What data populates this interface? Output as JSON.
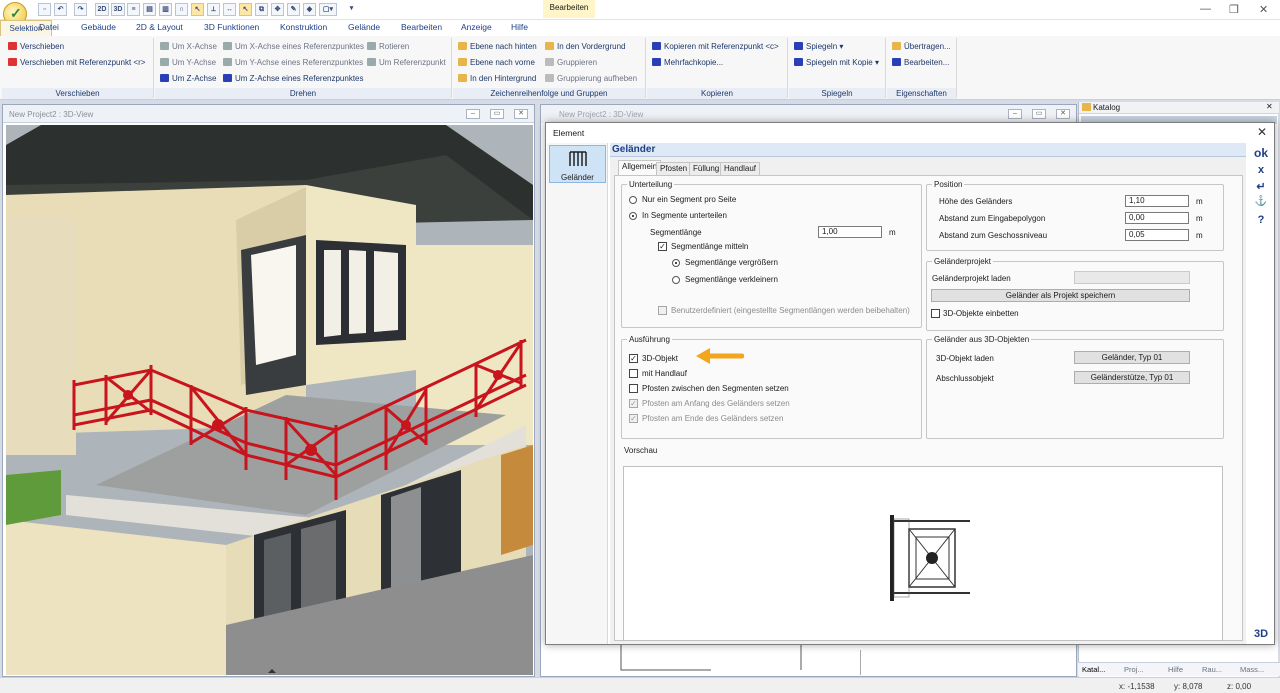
{
  "titlebar": {
    "context_tab": "Bearbeiten"
  },
  "quick_access": [
    "2D",
    "3D"
  ],
  "tabs": [
    "Datei",
    "Gebäude",
    "2D & Layout",
    "3D Funktionen",
    "Konstruktion",
    "Gelände",
    "Bearbeiten",
    "Anzeige",
    "Hilfe",
    "Selektion"
  ],
  "ribbon": {
    "verschieben": {
      "label": "Verschieben",
      "items": [
        "Verschieben",
        "Verschieben mit Referenzpunkt <r>"
      ]
    },
    "drehen": {
      "label": "Drehen",
      "items": [
        "Um X-Achse",
        "Um Y-Achse",
        "Um Z-Achse",
        "Um X-Achse eines Referenzpunktes",
        "Um Y-Achse eines Referenzpunktes",
        "Um Z-Achse eines Referenzpunktes",
        "Rotieren",
        "Um Referenzpunkt"
      ]
    },
    "zeichen": {
      "label": "Zeichenreihenfolge und Gruppen",
      "items": [
        "Ebene nach hinten",
        "Ebene nach vorne",
        "In den Hintergrund",
        "In den Vordergrund",
        "Gruppieren",
        "Gruppierung aufheben"
      ]
    },
    "kopieren": {
      "label": "Kopieren",
      "items": [
        "Kopieren mit Referenzpunkt <c>",
        "Mehrfachkopie..."
      ]
    },
    "spiegeln": {
      "label": "Spiegeln",
      "items": [
        "Spiegeln",
        "Spiegeln mit Kopie"
      ]
    },
    "eigenschaften": {
      "label": "Eigenschaften",
      "items": [
        "Übertragen...",
        "Bearbeiten..."
      ]
    }
  },
  "view3d": {
    "title": "New Project2 : 3D-View"
  },
  "view3d_2": {
    "title": "New Project2 : 3D-View"
  },
  "catalog": {
    "title": "Katalog",
    "tabs": [
      "Katal...",
      "Proj...",
      "Hilfe",
      "Rau...",
      "Mass..."
    ]
  },
  "status": {
    "x": "x: -1,1538",
    "y": "y: 8,078",
    "z": "z: 0,00"
  },
  "dialog": {
    "title": "Element",
    "element_label": "Geländer",
    "header": "Geländer",
    "tabs": [
      "Allgemein",
      "Pfosten",
      "Füllung",
      "Handlauf"
    ],
    "unterteilung": {
      "label": "Unterteilung",
      "radio_nur": "Nur ein Segment pro Seite",
      "radio_in": "In Segmente unterteilen",
      "segmentlaenge_label": "Segmentlänge",
      "segmentlaenge_value": "1,00",
      "unit": "m",
      "mitteln": "Segmentlänge mitteln",
      "vergroessern": "Segmentlänge vergrößern",
      "verkleinern": "Segmentlänge verkleinern",
      "benutzer": "Benutzerdefiniert (eingestellte Segmentlängen werden beibehalten)"
    },
    "position": {
      "label": "Position",
      "hoehe_label": "Höhe des Geländers",
      "hoehe_value": "1,10",
      "abstand_eingabe_label": "Abstand zum Eingabepolygon",
      "abstand_eingabe_value": "0,00",
      "abstand_geschoss_label": "Abstand zum Geschossniveau",
      "abstand_geschoss_value": "0,05",
      "unit": "m"
    },
    "projekt": {
      "label": "Geländerprojekt",
      "laden_label": "Geländerprojekt laden",
      "speichern_button": "Geländer als Projekt speichern",
      "einbetten": "3D-Objekte einbetten"
    },
    "ausfuehrung": {
      "label": "Ausführung",
      "objekt3d": "3D-Objekt",
      "handlauf": "mit Handlauf",
      "pfosten_zwischen": "Pfosten zwischen den Segmenten setzen",
      "pfosten_anfang": "Pfosten am Anfang des Geländers setzen",
      "pfosten_ende": "Pfosten am Ende des Geländers setzen"
    },
    "aus3d": {
      "label": "Geländer aus 3D-Objekten",
      "laden_label": "3D-Objekt laden",
      "laden_button": "Geländer, Typ 01",
      "abschluss_label": "Abschlussobjekt",
      "abschluss_button": "Geländerstütze, Typ 01"
    },
    "vorschau": {
      "label": "Vorschau"
    },
    "sidebar": {
      "ok": "ok",
      "cancel": "x",
      "undo": "↵",
      "anchor": "⚓",
      "help": "?",
      "view3d": "3D"
    }
  },
  "colors": {
    "accent": "#1e3f86",
    "railing": "#c8141c",
    "arrow": "#f3a51b",
    "wall": "#f4ecd0"
  }
}
